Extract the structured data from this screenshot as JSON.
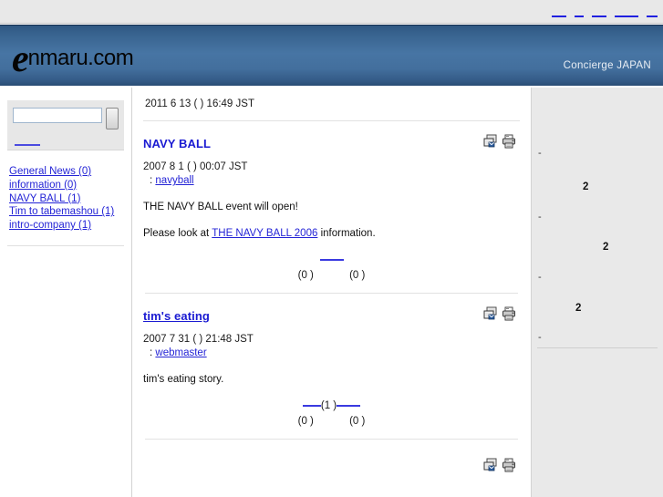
{
  "browser": {
    "top_links": [
      "",
      "",
      "",
      "",
      ""
    ]
  },
  "header": {
    "logo_initial": "e",
    "logo_rest": "nmaru.com",
    "tagline": "Concierge JAPAN"
  },
  "sidebar_left": {
    "search": {
      "value": "",
      "placeholder": "",
      "button_label": "",
      "advanced_label": ""
    },
    "categories": [
      {
        "label": "General News (0)"
      },
      {
        "label": "information (0)"
      },
      {
        "label": "NAVY BALL (1)"
      },
      {
        "label": "Tim to tabemashou (1)"
      },
      {
        "label": "intro-company (1)"
      }
    ]
  },
  "main": {
    "current_datetime": "2011 6 13 ( ) 16:49 JST",
    "articles": [
      {
        "title": "NAVY BALL",
        "title_is_link": false,
        "date": "2007 8  1 ( ) 00:07 JST",
        "author_prefix": ":",
        "author": "navyball",
        "body_lines": [
          "THE NAVY BALL event will open!"
        ],
        "body_link_prefix": "Please look at ",
        "body_link": "THE NAVY BALL 2006",
        "body_link_suffix": " information.",
        "footer": {
          "read_more": "",
          "comment_count": "",
          "more_link": "",
          "count_left": "(0 )",
          "count_right": "(0 )"
        },
        "icons": {
          "recommend": "recommend-icon",
          "print": "print-icon"
        }
      },
      {
        "title": "tim's eating",
        "title_is_link": true,
        "date": "2007 7 31 ( ) 21:48 JST",
        "author_prefix": ":",
        "author": "webmaster",
        "body_lines": [
          "tim's eating story."
        ],
        "body_link_prefix": "",
        "body_link": "",
        "body_link_suffix": "",
        "footer": {
          "read_more": "",
          "comment_count": "(1    )",
          "more_link": "",
          "count_left": "(0 )",
          "count_right": "(0 )"
        },
        "icons": {
          "recommend": "recommend-icon",
          "print": "print-icon"
        }
      },
      {
        "title": "",
        "title_is_link": true,
        "date": "",
        "author_prefix": "",
        "author": "",
        "body_lines": [],
        "body_link_prefix": "",
        "body_link": "",
        "body_link_suffix": "",
        "footer": {
          "read_more": "",
          "comment_count": "",
          "more_link": "",
          "count_left": "",
          "count_right": ""
        },
        "icons": {
          "recommend": "recommend-icon",
          "print": "print-icon"
        }
      }
    ]
  },
  "sidebar_right": {
    "items": [
      {
        "bullet": "-",
        "number": "2"
      },
      {
        "bullet": "-",
        "number": "2"
      },
      {
        "bullet": "-",
        "number": "2"
      },
      {
        "bullet": "-",
        "number": ""
      }
    ]
  }
}
